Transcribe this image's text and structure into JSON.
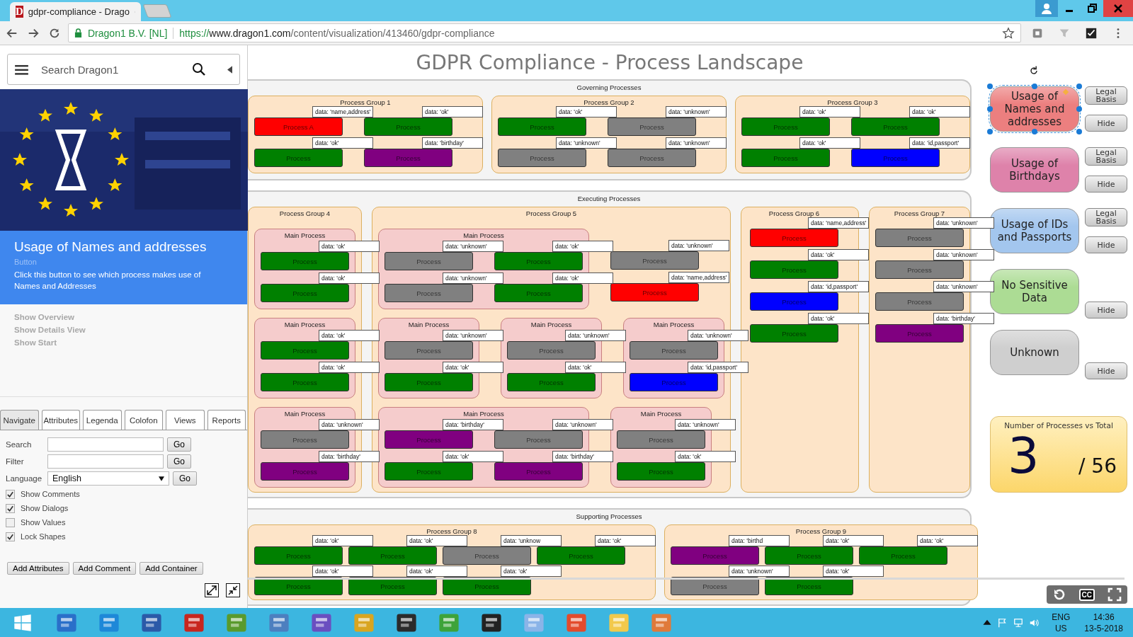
{
  "browser": {
    "tab_icon": "D",
    "tab_title": "gdpr-compliance - Drago",
    "site_identity": "Dragon1 B.V. [NL]",
    "url_scheme": "https://",
    "url_host": "www.dragon1.com",
    "url_path": "/content/visualization/413460/gdpr-compliance"
  },
  "sidebar": {
    "search": {
      "placeholder": "Search Dragon1"
    },
    "info": {
      "title": "Usage of Names and addresses",
      "type": "Button",
      "description": "Click this button to see which process makes use of Names and Addresses"
    },
    "links": [
      {
        "label": "Show Overview",
        "disabled": true
      },
      {
        "label": "Show Details View",
        "disabled": true
      },
      {
        "label": "Show Start",
        "disabled": true
      }
    ],
    "tabs": [
      {
        "label": "Navigate",
        "selected": true
      },
      {
        "label": "Attributes",
        "selected": false
      },
      {
        "label": "Legenda",
        "selected": false
      },
      {
        "label": "Colofon",
        "selected": false
      },
      {
        "label": "Views",
        "selected": false
      },
      {
        "label": "Reports",
        "selected": false
      }
    ],
    "form": [
      {
        "label": "Search",
        "kind": "text",
        "button": "Go"
      },
      {
        "label": "Filter",
        "kind": "text",
        "button": "Go"
      },
      {
        "label": "Language",
        "kind": "select",
        "value": "English",
        "button": "Go"
      }
    ],
    "options": [
      {
        "label": "Show Comments",
        "checked": true
      },
      {
        "label": "Show Dialogs",
        "checked": true
      },
      {
        "label": "Show Values",
        "checked": false
      },
      {
        "label": "Lock Shapes",
        "checked": true
      }
    ],
    "actions": [
      "Add Attributes",
      "Add Comment",
      "Add Container"
    ]
  },
  "diagram": {
    "title": "GDPR Compliance - Process Landscape",
    "sections": [
      {
        "title": "Governing Processes",
        "groups": [
          {
            "title": "Process Group 1",
            "tiers": [
              [
                {
                  "kind": "plain",
                  "rows": [
                    [
                      {
                        "label": "Process A",
                        "color": "#ff0000",
                        "tag": "data: 'name,address'"
                      },
                      {
                        "label": "Process",
                        "color": "#008000",
                        "tag": "data: 'ok'"
                      }
                    ],
                    [
                      {
                        "label": "Process",
                        "color": "#008000",
                        "tag": "data: 'ok'"
                      },
                      {
                        "label": "Process",
                        "color": "#800080",
                        "tag": "data: 'birthday'"
                      }
                    ]
                  ]
                }
              ]
            ]
          },
          {
            "title": "Process Group 2",
            "tiers": [
              [
                {
                  "kind": "plain",
                  "rows": [
                    [
                      {
                        "label": "Process",
                        "color": "#008000",
                        "tag": "data: 'ok'"
                      },
                      {
                        "label": "Process",
                        "color": "#808080",
                        "tag": "data: 'unknown'"
                      }
                    ],
                    [
                      {
                        "label": "Process",
                        "color": "#808080",
                        "tag": "data: 'unknown'"
                      },
                      {
                        "label": "Process",
                        "color": "#808080",
                        "tag": "data: 'unknown'"
                      }
                    ]
                  ]
                }
              ]
            ]
          },
          {
            "title": "Process Group 3",
            "tiers": [
              [
                {
                  "kind": "plain",
                  "rows": [
                    [
                      {
                        "label": "Process",
                        "color": "#008000",
                        "tag": "data: 'ok'"
                      },
                      {
                        "label": "Process",
                        "color": "#008000",
                        "tag": "data: 'ok'"
                      }
                    ],
                    [
                      {
                        "label": "Process",
                        "color": "#008000",
                        "tag": "data: 'ok'"
                      },
                      {
                        "label": "Process",
                        "color": "#0000ff",
                        "tag": "data: 'id,passport'"
                      }
                    ]
                  ]
                }
              ]
            ]
          }
        ]
      },
      {
        "title": "Executing Processes",
        "groups": [
          {
            "title": "Process Group 4",
            "tiers": [
              [
                {
                  "kind": "main",
                  "title": "Main Process",
                  "rows": [
                    [
                      {
                        "label": "Process",
                        "color": "#008000",
                        "tag": "data: 'ok'"
                      }
                    ],
                    [
                      {
                        "label": "Process",
                        "color": "#008000",
                        "tag": "data: 'ok'"
                      }
                    ]
                  ]
                }
              ],
              [
                {
                  "kind": "main",
                  "title": "Main Process",
                  "rows": [
                    [
                      {
                        "label": "Process",
                        "color": "#008000",
                        "tag": "data: 'ok'"
                      }
                    ],
                    [
                      {
                        "label": "Process",
                        "color": "#008000",
                        "tag": "data: 'ok'"
                      }
                    ]
                  ]
                }
              ],
              [
                {
                  "kind": "main",
                  "title": "Main Process",
                  "rows": [
                    [
                      {
                        "label": "Process",
                        "color": "#808080",
                        "tag": "data: 'unknown'"
                      }
                    ],
                    [
                      {
                        "label": "Process",
                        "color": "#800080",
                        "tag": "data: 'birthday'"
                      }
                    ]
                  ]
                }
              ]
            ]
          },
          {
            "title": "Process Group 5",
            "tiers": [
              [
                {
                  "kind": "main",
                  "title": "Main Process",
                  "rows": [
                    [
                      {
                        "label": "Process",
                        "color": "#808080",
                        "tag": "data: 'unknown'"
                      },
                      {
                        "label": "Process",
                        "color": "#008000",
                        "tag": "data: 'ok'"
                      }
                    ],
                    [
                      {
                        "label": "Process",
                        "color": "#808080",
                        "tag": "data: 'unknown'"
                      },
                      {
                        "label": "Process",
                        "color": "#008000",
                        "tag": "data: 'ok'"
                      }
                    ]
                  ]
                },
                {
                  "kind": "plain",
                  "rows": [
                    [
                      {
                        "label": "Process",
                        "color": "#808080",
                        "tag": "data: 'unknown'"
                      }
                    ],
                    [
                      {
                        "label": "Process",
                        "color": "#ff0000",
                        "tag": "data: 'name,address'"
                      }
                    ]
                  ]
                }
              ],
              [
                {
                  "kind": "main",
                  "title": "Main Process",
                  "rows": [
                    [
                      {
                        "label": "Process",
                        "color": "#808080",
                        "tag": "data: 'unknown'"
                      }
                    ],
                    [
                      {
                        "label": "Process",
                        "color": "#008000",
                        "tag": "data: 'ok'"
                      }
                    ]
                  ]
                },
                {
                  "kind": "main",
                  "title": "Main Process",
                  "rows": [
                    [
                      {
                        "label": "Process",
                        "color": "#808080",
                        "tag": "data: 'unknown'"
                      }
                    ],
                    [
                      {
                        "label": "Process",
                        "color": "#008000",
                        "tag": "data: 'ok'"
                      }
                    ]
                  ]
                },
                {
                  "kind": "main",
                  "title": "Main Process",
                  "rows": [
                    [
                      {
                        "label": "Process",
                        "color": "#808080",
                        "tag": "data: 'unknown'"
                      }
                    ],
                    [
                      {
                        "label": "Process",
                        "color": "#0000ff",
                        "tag": "data: 'id,passport'"
                      }
                    ]
                  ]
                }
              ],
              [
                {
                  "kind": "main",
                  "title": "Main Process",
                  "rows": [
                    [
                      {
                        "label": "Process",
                        "color": "#800080",
                        "tag": "data: 'birthday'"
                      },
                      {
                        "label": "Process",
                        "color": "#808080",
                        "tag": "data: 'unknown'"
                      }
                    ],
                    [
                      {
                        "label": "Process",
                        "color": "#008000",
                        "tag": "data: 'ok'"
                      },
                      {
                        "label": "Process",
                        "color": "#800080",
                        "tag": "data: 'birthday'"
                      }
                    ]
                  ]
                },
                {
                  "kind": "main",
                  "title": "Main Process",
                  "rows": [
                    [
                      {
                        "label": "Process",
                        "color": "#808080",
                        "tag": "data: 'unknown'"
                      }
                    ],
                    [
                      {
                        "label": "Process",
                        "color": "#008000",
                        "tag": "data: 'ok'"
                      }
                    ]
                  ]
                }
              ]
            ]
          },
          {
            "title": "Process Group 6",
            "tiers": [
              [
                {
                  "kind": "plain",
                  "rows": [
                    [
                      {
                        "label": "Process",
                        "color": "#ff0000",
                        "tag": "data: 'name,address'"
                      }
                    ],
                    [
                      {
                        "label": "Process",
                        "color": "#008000",
                        "tag": "data: 'ok'"
                      }
                    ],
                    [
                      {
                        "label": "Process",
                        "color": "#0000ff",
                        "tag": "data: 'id,passport'"
                      }
                    ],
                    [
                      {
                        "label": "Process",
                        "color": "#008000",
                        "tag": "data: 'ok'"
                      }
                    ]
                  ]
                }
              ]
            ]
          },
          {
            "title": "Process Group 7",
            "tiers": [
              [
                {
                  "kind": "plain",
                  "rows": [
                    [
                      {
                        "label": "Process",
                        "color": "#808080",
                        "tag": "data: 'unknown'"
                      }
                    ],
                    [
                      {
                        "label": "Process",
                        "color": "#808080",
                        "tag": "data: 'unknown'"
                      }
                    ],
                    [
                      {
                        "label": "Process",
                        "color": "#808080",
                        "tag": "data: 'unknown'"
                      }
                    ],
                    [
                      {
                        "label": "Process",
                        "color": "#800080",
                        "tag": "data: 'birthday'"
                      }
                    ]
                  ]
                }
              ]
            ]
          }
        ]
      },
      {
        "title": "Supporting Processes",
        "groups": [
          {
            "title": "Process Group 8",
            "tiers": [
              [
                {
                  "kind": "plain",
                  "rows": [
                    [
                      {
                        "label": "Process",
                        "color": "#008000",
                        "tag": "data: 'ok'"
                      },
                      {
                        "label": "Process",
                        "color": "#008000",
                        "tag": "data: 'ok'"
                      },
                      {
                        "label": "Process",
                        "color": "#808080",
                        "tag": "data: 'unknow"
                      },
                      {
                        "label": "Process",
                        "color": "#008000",
                        "tag": "data: 'ok'"
                      }
                    ],
                    [
                      {
                        "label": "Process",
                        "color": "#008000",
                        "tag": "data: 'ok'"
                      },
                      {
                        "label": "Process",
                        "color": "#008000",
                        "tag": "data: 'ok'"
                      },
                      {
                        "label": "Process",
                        "color": "#008000",
                        "tag": "data: 'ok'"
                      }
                    ]
                  ]
                }
              ]
            ]
          },
          {
            "title": "Process Group 9",
            "tiers": [
              [
                {
                  "kind": "plain",
                  "rows": [
                    [
                      {
                        "label": "Process",
                        "color": "#800080",
                        "tag": "data: 'birthd"
                      },
                      {
                        "label": "Process",
                        "color": "#008000",
                        "tag": "data: 'ok'"
                      },
                      {
                        "label": "Process",
                        "color": "#008000",
                        "tag": "data: 'ok'"
                      }
                    ],
                    [
                      {
                        "label": "Process",
                        "color": "#808080",
                        "tag": "data: 'unknown'"
                      },
                      {
                        "label": "Process",
                        "color": "#008000",
                        "tag": "data: 'ok'"
                      }
                    ]
                  ]
                }
              ]
            ]
          }
        ]
      }
    ]
  },
  "legend": [
    {
      "label": "Usage of Names and addresses",
      "color": "#ec7f7f",
      "selected": true,
      "legal_basis": "Legal Basis",
      "hide": "Hide"
    },
    {
      "label": "Usage of Birthdays",
      "color": "#de82aa",
      "selected": false,
      "legal_basis": "Legal Basis",
      "hide": "Hide"
    },
    {
      "label": "Usage of IDs and Passports",
      "color": "#a3c6ee",
      "selected": false,
      "legal_basis": "Legal Basis",
      "hide": "Hide"
    },
    {
      "label": "No Sensitive Data",
      "color": "#acdc94",
      "selected": false,
      "hide": "Hide"
    },
    {
      "label": "Unknown",
      "color": "#cfcfcf",
      "selected": false,
      "hide": "Hide"
    }
  ],
  "counter": {
    "title": "Number of Processes vs Total",
    "value": "3",
    "total": "/ 56"
  },
  "player": {
    "level": 1,
    "captions": "CC"
  },
  "taskbar": {
    "language": "ENG",
    "region": "US",
    "time": "14:36",
    "date": "13-5-2018"
  }
}
